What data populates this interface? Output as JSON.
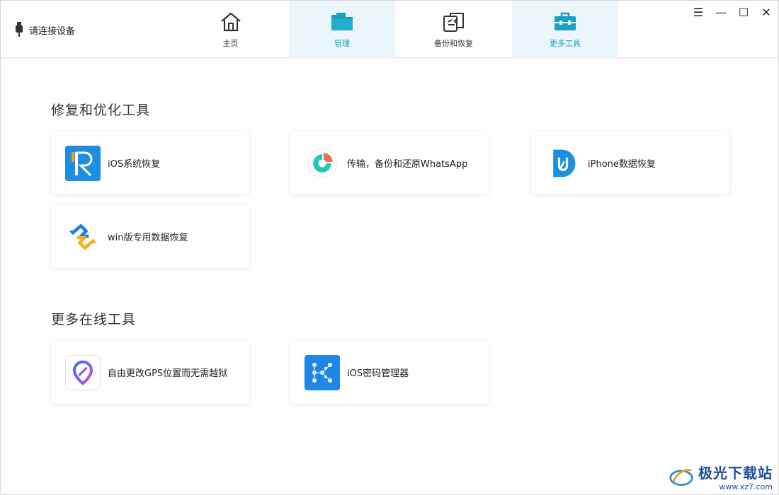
{
  "header": {
    "device_status": "请连接设备",
    "tabs": [
      {
        "label": "主页",
        "icon": "home-icon"
      },
      {
        "label": "管理",
        "icon": "folder-icon"
      },
      {
        "label": "备份和恢复",
        "icon": "backup-restore-icon"
      },
      {
        "label": "更多工具",
        "icon": "toolbox-icon"
      }
    ],
    "window_controls": {
      "menu": "☰",
      "minimize": "—",
      "maximize": "☐",
      "close": "✕"
    }
  },
  "sections": {
    "repair": {
      "title": "修复和优化工具",
      "cards": [
        {
          "label": "iOS系统恢复",
          "icon": "ios-repair-icon"
        },
        {
          "label": "传输，备份和还原WhatsApp",
          "icon": "whatsapp-transfer-icon"
        },
        {
          "label": "iPhone数据恢复",
          "icon": "iphone-data-recovery-icon"
        },
        {
          "label": "win版专用数据恢复",
          "icon": "win-data-recovery-icon"
        }
      ]
    },
    "online": {
      "title": "更多在线工具",
      "cards": [
        {
          "label": "自由更改GPS位置而无需越狱",
          "icon": "gps-location-icon"
        },
        {
          "label": "iOS密码管理器",
          "icon": "password-manager-icon"
        }
      ]
    }
  },
  "watermark": {
    "name": "极光下载站",
    "url": "www.xz7.com"
  },
  "colors": {
    "accent": "#1b9fc2",
    "active_tab_bg": "#eaf6fa"
  }
}
